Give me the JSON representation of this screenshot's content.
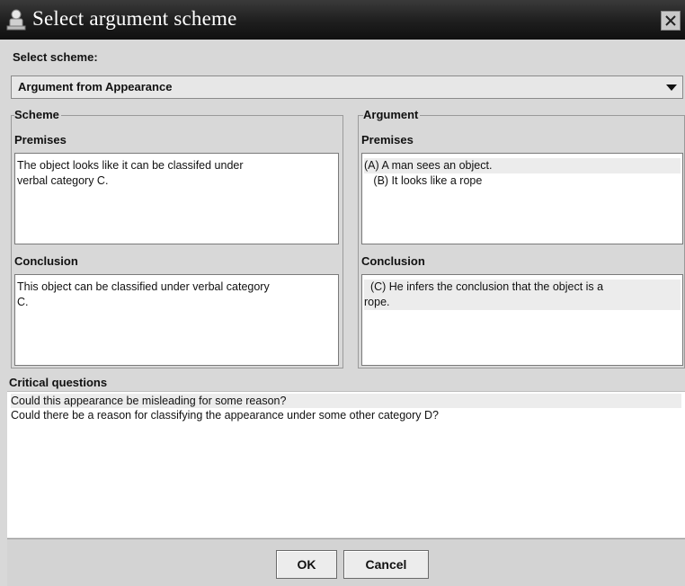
{
  "window": {
    "title": "Select argument scheme",
    "icon": "app-icon",
    "close": "close-icon"
  },
  "select_scheme": {
    "label": "Select scheme:",
    "selected": "Argument from Appearance"
  },
  "scheme": {
    "title": "Scheme",
    "premises_label": "Premises",
    "premises_lines": [
      "The object looks like it can be classifed under",
      "verbal category C."
    ],
    "conclusion_label": "Conclusion",
    "conclusion_lines": [
      "This object can be classified under verbal category",
      "C."
    ]
  },
  "argument": {
    "title": "Argument",
    "premises_label": "Premises",
    "premises_lines": [
      "(A) A man sees an object.",
      "   (B) It looks like a rope"
    ],
    "conclusion_label": "Conclusion",
    "conclusion_lines": [
      "  (C) He infers the conclusion that the object is a",
      "rope."
    ]
  },
  "critical_questions": {
    "label": "Critical questions",
    "items": [
      "Could this appearance be misleading for some reason?",
      "Could there be a reason for classifying the appearance under some other category D?"
    ]
  },
  "buttons": {
    "ok": "OK",
    "cancel": "Cancel"
  }
}
